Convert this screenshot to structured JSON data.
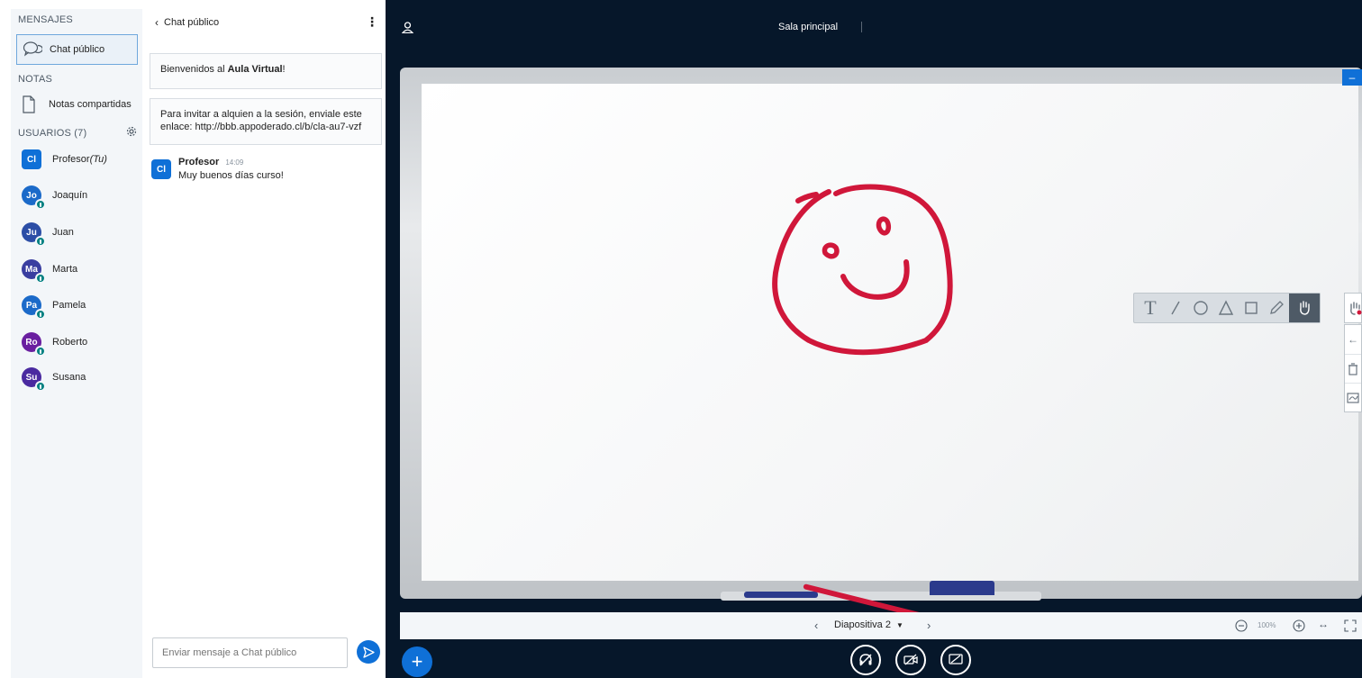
{
  "sidebar": {
    "messages_title": "MENSAJES",
    "public_chat_label": "Chat público",
    "notes_title": "NOTAS",
    "shared_notes_label": "Notas compartidas",
    "users_title": "USUARIOS (7)",
    "users": [
      {
        "initials": "Cl",
        "name": "Profesor",
        "suffix": "(Tu)",
        "color": "#0f70d7"
      },
      {
        "initials": "Jo",
        "name": "Joaquín",
        "color": "#1b6ac9"
      },
      {
        "initials": "Ju",
        "name": "Juan",
        "color": "#2c4ea6"
      },
      {
        "initials": "Ma",
        "name": "Marta",
        "color": "#3a3ea0"
      },
      {
        "initials": "Pa",
        "name": "Pamela",
        "color": "#1b6ac9"
      },
      {
        "initials": "Ro",
        "name": "Roberto",
        "color": "#6a1fa0"
      },
      {
        "initials": "Su",
        "name": "Susana",
        "color": "#4a2aa0"
      }
    ]
  },
  "chat": {
    "header_back": "Chat público",
    "welcome_prefix": "Bienvenidos al ",
    "welcome_bold": "Aula Virtual",
    "welcome_suffix": "!",
    "invite_text": "Para invitar a alquien a la sesión, enviale este enlace: http://bbb.appoderado.cl/b/cla-au7-vzf",
    "message": {
      "avatar": "Cl",
      "author": "Profesor",
      "time": "14:09",
      "text": "Muy buenos días curso!"
    },
    "input_placeholder": "Enviar mensaje a Chat público"
  },
  "main": {
    "room_title": "Sala principal",
    "slide_label": "Diapositiva 2",
    "zoom_level": "100%"
  },
  "colors": {
    "accent": "#0f70d7",
    "dark_bg": "#06172a",
    "drawing": "#d0173a"
  }
}
